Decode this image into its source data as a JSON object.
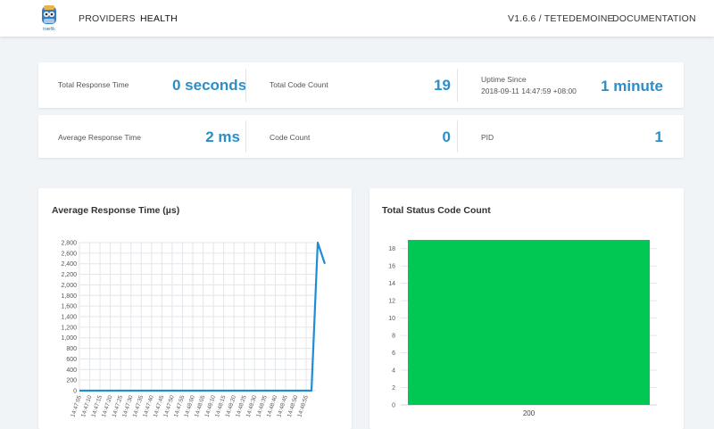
{
  "nav": {
    "providers": "PROVIDERS",
    "health": "HEALTH",
    "version": "V1.6.6 / TETEDEMOINE",
    "documentation": "DOCUMENTATION",
    "logo_text": "træfik"
  },
  "stats": {
    "total_response_time": {
      "label": "Total Response Time",
      "value": "0 seconds"
    },
    "total_code_count": {
      "label": "Total Code Count",
      "value": "19"
    },
    "uptime": {
      "label": "Uptime Since",
      "since": "2018-09-11 14:47:59 +08:00",
      "value": "1 minute"
    },
    "avg_response_time": {
      "label": "Average Response Time",
      "value": "2 ms"
    },
    "code_count": {
      "label": "Code Count",
      "value": "0"
    },
    "pid": {
      "label": "PID",
      "value": "1"
    }
  },
  "colors": {
    "accent": "#2b8fc7",
    "line": "#1f8dd6",
    "bar": "#00c853"
  },
  "chart_data": [
    {
      "type": "line",
      "title": "Average Response Time (µs)",
      "x": [
        "14:47:05",
        "14:47:10",
        "14:47:15",
        "14:47:20",
        "14:47:25",
        "14:47:30",
        "14:47:35",
        "14:47:40",
        "14:47:45",
        "14:47:50",
        "14:47:55",
        "14:48:00",
        "14:48:05",
        "14:48:10",
        "14:48:15",
        "14:48:20",
        "14:48:25",
        "14:48:30",
        "14:48:35",
        "14:48:40",
        "14:48:45",
        "14:48:50",
        "14:48:55"
      ],
      "yticks": [
        "0",
        "200",
        "400",
        "600",
        "800",
        "1,000",
        "1,200",
        "1,400",
        "1,600",
        "1,800",
        "2,000",
        "2,200",
        "2,400",
        "2,600",
        "2,800"
      ],
      "ylim": [
        0,
        2800
      ],
      "series": [
        {
          "values": [
            0,
            0,
            0,
            0,
            0,
            0,
            0,
            0,
            0,
            0,
            0,
            0,
            0,
            0,
            0,
            0,
            0,
            0,
            0,
            0,
            0,
            0,
            0,
            0,
            2800,
            2400
          ]
        }
      ]
    },
    {
      "type": "bar",
      "title": "Total Status Code Count",
      "categories": [
        "200"
      ],
      "values": [
        19
      ],
      "yticks": [
        "0",
        "2",
        "4",
        "6",
        "8",
        "10",
        "12",
        "14",
        "16",
        "18"
      ],
      "ylim": [
        0,
        19
      ]
    }
  ]
}
